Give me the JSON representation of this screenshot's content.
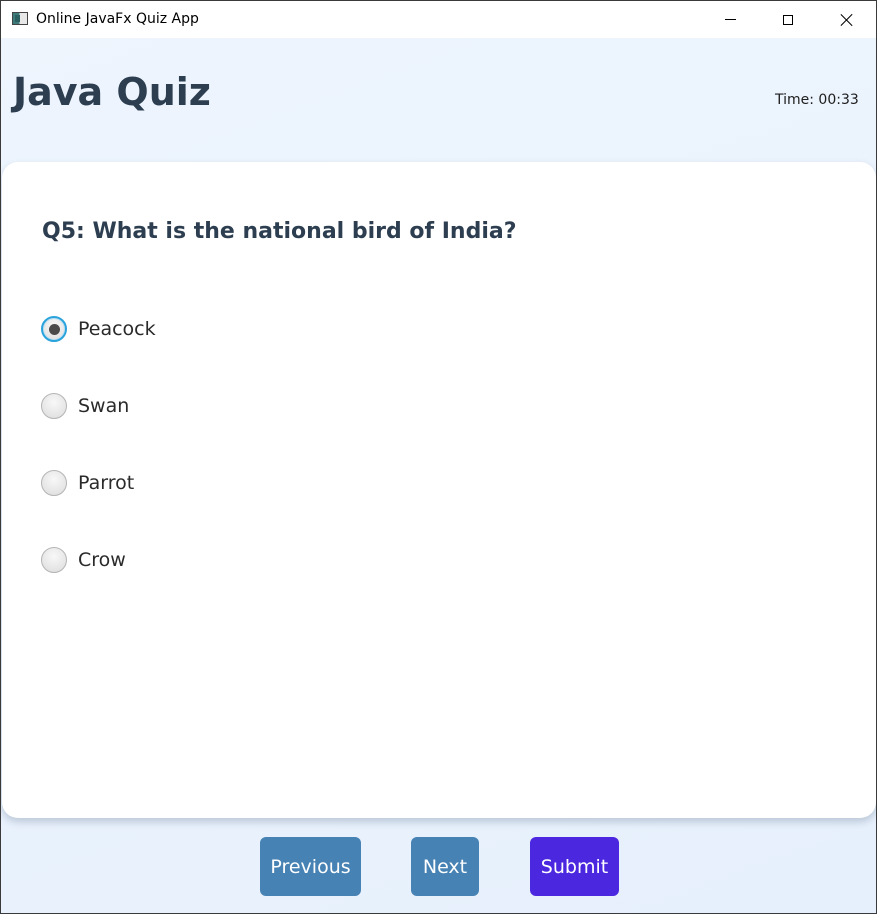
{
  "window": {
    "title": "Online JavaFx Quiz App",
    "icon": "app-window-icon",
    "controls": {
      "minimize_icon": "minimize-icon",
      "maximize_icon": "maximize-icon",
      "close_icon": "close-icon"
    }
  },
  "header": {
    "title": "Java Quiz",
    "timer": "Time: 00:33"
  },
  "question": {
    "text": "Q5: What is the national bird of India?",
    "options": [
      {
        "label": "Peacock",
        "selected": true
      },
      {
        "label": "Swan",
        "selected": false
      },
      {
        "label": "Parrot",
        "selected": false
      },
      {
        "label": "Crow",
        "selected": false
      }
    ]
  },
  "buttons": {
    "previous": "Previous",
    "next": "Next",
    "submit": "Submit"
  },
  "colors": {
    "nav_button": "#4682b4",
    "submit_button": "#4b28df",
    "heading_text": "#2c3e50",
    "radio_focus": "#2aa3dc"
  }
}
